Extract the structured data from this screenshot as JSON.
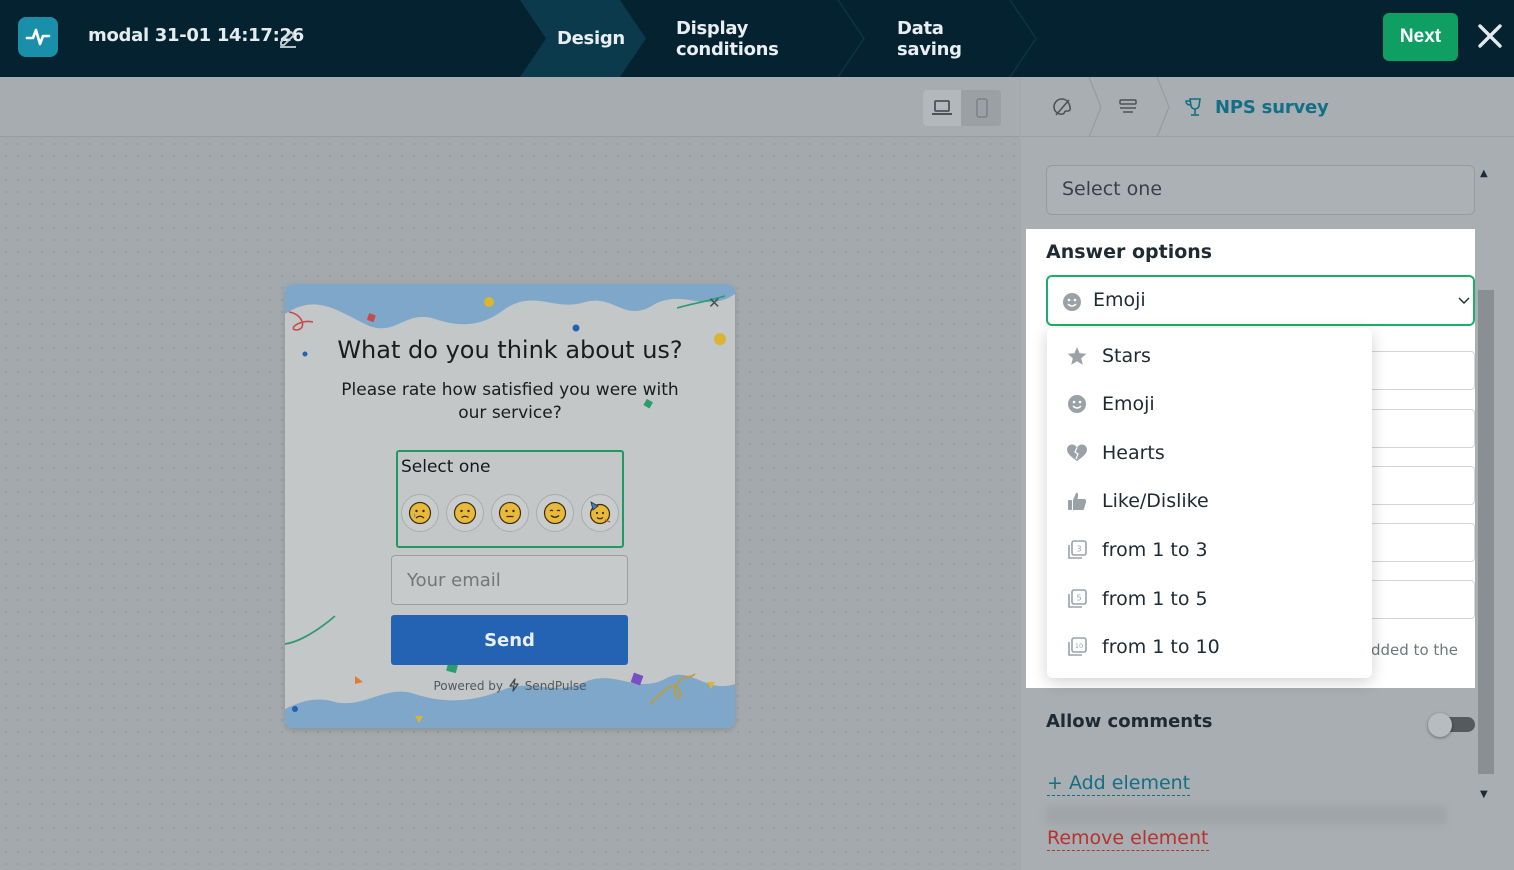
{
  "header": {
    "form_title": "modal 31-01 14:17:26",
    "steps": [
      {
        "label": "Design",
        "active": true
      },
      {
        "label": "Display conditions",
        "active": false
      },
      {
        "label": "Data saving",
        "active": false
      }
    ],
    "next_label": "Next"
  },
  "canvas": {
    "device_modes": [
      "desktop",
      "mobile"
    ],
    "active_device": "desktop"
  },
  "popup": {
    "title": "What do you think about us?",
    "subtitle": "Please rate how satisfied you were with our service?",
    "nps_label": "Select one",
    "emojis": [
      "crying-face",
      "frowning-face",
      "neutral-face",
      "smiling-face",
      "partying-face"
    ],
    "email_placeholder": "Your email",
    "send_label": "Send",
    "powered_by": "Powered by",
    "brand": "SendPulse"
  },
  "panel": {
    "breadcrumb_title": "NPS survey",
    "select_one_value": "Select one",
    "answer_options_label": "Answer options",
    "answer_options_selected": "Emoji",
    "dropdown_items": [
      {
        "label": "Stars",
        "icon": "star-icon"
      },
      {
        "label": "Emoji",
        "icon": "emoji-icon"
      },
      {
        "label": "Hearts",
        "icon": "heart-icon"
      },
      {
        "label": "Like/Dislike",
        "icon": "thumbs-up-icon"
      },
      {
        "label": "from 1 to 3",
        "icon": "scale-3-icon"
      },
      {
        "label": "from 1 to 5",
        "icon": "scale-5-icon"
      },
      {
        "label": "from 1 to 10",
        "icon": "scale-10-icon"
      }
    ],
    "hint_fragment": "dded to the",
    "allow_comments_label": "Allow comments",
    "allow_comments_on": false,
    "add_element_label": "+ Add element",
    "remove_element_label": "Remove element"
  },
  "colors": {
    "topbar": "#04222f",
    "accent_green": "#0f9f62",
    "link_teal": "#156e84",
    "danger": "#b5322e",
    "send_blue": "#2462b4"
  }
}
